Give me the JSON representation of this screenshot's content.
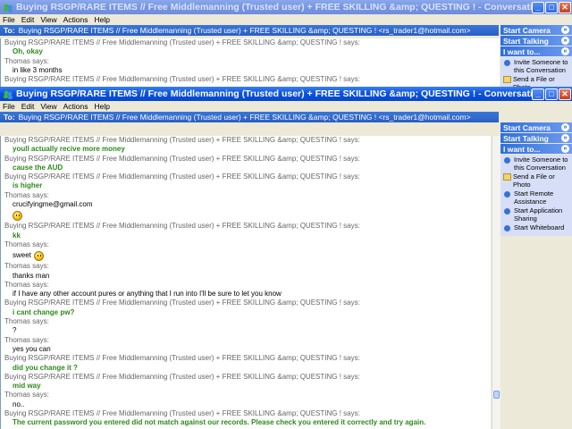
{
  "window": {
    "title": "Buying RSGP/RARE ITEMS // Free Middlemanning (Trusted user) + FREE SKILLING &amp; QUESTING ! - Conversation",
    "controls": {
      "minimize": "_",
      "maximize": "□",
      "close": "✕"
    }
  },
  "menu": [
    "File",
    "Edit",
    "View",
    "Actions",
    "Help"
  ],
  "to_bar": {
    "label": "To:",
    "recipient": "Buying RSGP/RARE ITEMS // Free Middlemanning (Trusted user) + FREE SKILLING &amp; QUESTING ! <rs_trader1@hotmail.com>"
  },
  "sidebar": {
    "start_camera": "Start Camera",
    "start_talking": "Start Talking",
    "i_want_to": "I want to...",
    "items_back": [
      "Invite Someone to this Conversation",
      "Send a File or Photo"
    ],
    "items_front": [
      "Invite Someone to this Conversation",
      "Send a File or Photo",
      "Start Remote Assistance",
      "Start Application Sharing",
      "Start Whiteboard"
    ]
  },
  "back_conversation": [
    {
      "kind": "says",
      "text": "Buying RSGP/RARE ITEMS // Free Middlemanning (Trusted user) + FREE SKILLING &amp; QUESTING ! says:"
    },
    {
      "kind": "green",
      "text": "Oh, okay"
    },
    {
      "kind": "says",
      "text": "Thomas says:"
    },
    {
      "kind": "msg",
      "text": "in like 3 months"
    },
    {
      "kind": "says",
      "text": "Buying RSGP/RARE ITEMS // Free Middlemanning (Trusted user) + FREE SKILLING &amp; QUESTING ! says:"
    }
  ],
  "conversation": [
    {
      "kind": "says",
      "text": "Buying RSGP/RARE ITEMS // Free Middlemanning (Trusted user) + FREE SKILLING &amp; QUESTING ! says:"
    },
    {
      "kind": "green",
      "text": "youll actually recive more money"
    },
    {
      "kind": "says",
      "text": "Buying RSGP/RARE ITEMS // Free Middlemanning (Trusted user) + FREE SKILLING &amp; QUESTING ! says:"
    },
    {
      "kind": "green",
      "text": "cause the AUD"
    },
    {
      "kind": "says",
      "text": "Buying RSGP/RARE ITEMS // Free Middlemanning (Trusted user) + FREE SKILLING &amp; QUESTING ! says:"
    },
    {
      "kind": "green",
      "text": "is higher"
    },
    {
      "kind": "says",
      "text": "Thomas says:"
    },
    {
      "kind": "msg",
      "text": "crucifyingme@gmail.com"
    },
    {
      "kind": "emote",
      "text": ""
    },
    {
      "kind": "says",
      "text": "Buying RSGP/RARE ITEMS // Free Middlemanning (Trusted user) + FREE SKILLING &amp; QUESTING ! says:"
    },
    {
      "kind": "green",
      "text": "kk"
    },
    {
      "kind": "says",
      "text": "Thomas says:"
    },
    {
      "kind": "emote",
      "text": "sweet"
    },
    {
      "kind": "says",
      "text": "Thomas says:"
    },
    {
      "kind": "msg",
      "text": "thanks man"
    },
    {
      "kind": "says",
      "text": "Thomas says:"
    },
    {
      "kind": "msg",
      "text": "if I have any other account pures or anything that I run into I'll be sure to let you know"
    },
    {
      "kind": "says",
      "text": "Buying RSGP/RARE ITEMS // Free Middlemanning (Trusted user) + FREE SKILLING &amp; QUESTING ! says:"
    },
    {
      "kind": "green",
      "text": "i cant change pw?"
    },
    {
      "kind": "says",
      "text": "Thomas says:"
    },
    {
      "kind": "msg",
      "text": "?"
    },
    {
      "kind": "says",
      "text": "Thomas says:"
    },
    {
      "kind": "msg",
      "text": "yes you can"
    },
    {
      "kind": "says",
      "text": "Buying RSGP/RARE ITEMS // Free Middlemanning (Trusted user) + FREE SKILLING &amp; QUESTING ! says:"
    },
    {
      "kind": "green",
      "text": "did you change it ?"
    },
    {
      "kind": "says",
      "text": "Buying RSGP/RARE ITEMS // Free Middlemanning (Trusted user) + FREE SKILLING &amp; QUESTING ! says:"
    },
    {
      "kind": "green",
      "text": "mid way"
    },
    {
      "kind": "says",
      "text": "Thomas says:"
    },
    {
      "kind": "msg",
      "text": "no.."
    },
    {
      "kind": "says",
      "text": "Buying RSGP/RARE ITEMS // Free Middlemanning (Trusted user) + FREE SKILLING &amp; QUESTING ! says:"
    },
    {
      "kind": "green",
      "text": "The current password you entered did not match against our records. Please check you entered it correctly and try again."
    }
  ]
}
